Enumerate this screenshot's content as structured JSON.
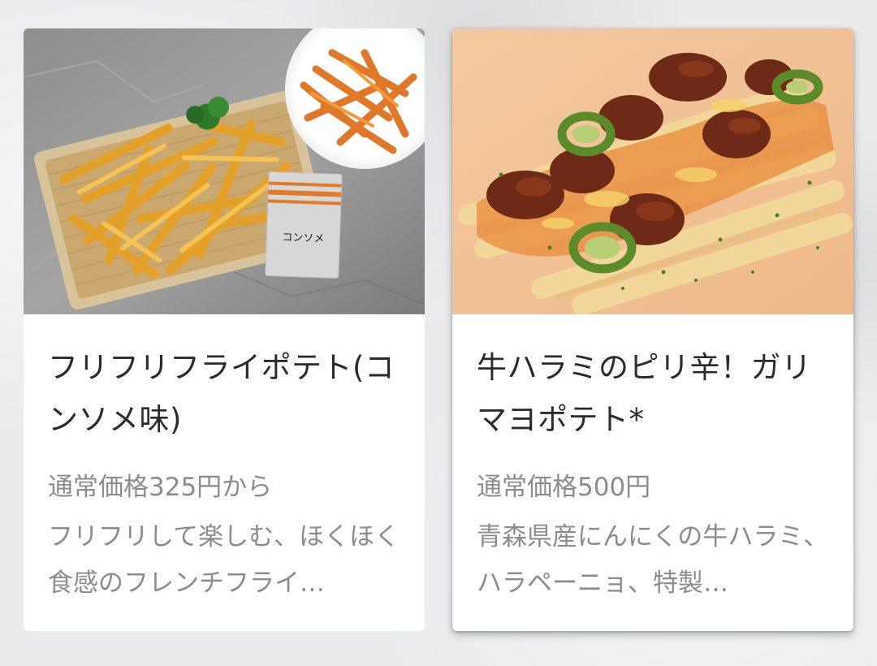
{
  "menu_items": [
    {
      "name": "フリフリフライポテト(コンソメ味)",
      "price_text": "通常価格325円から",
      "description": "フリフリして楽しむ、ほくほく食感のフレンチフライ…",
      "image": {
        "subject": "french-fries-in-basket-with-seasoning-packet",
        "packet_label": "コンソメ"
      }
    },
    {
      "name": "牛ハラミのピリ辛！ガリマヨポテト*",
      "price_text": "通常価格500円",
      "description": "青森県産にんにくの牛ハラミ、ハラペーニョ、特製…",
      "image": {
        "subject": "fries-topped-with-beef-skirt-jalapeno-mayo"
      }
    }
  ],
  "colors": {
    "background": "#e9ebec",
    "card": "#ffffff",
    "title_text": "#2b2b2b",
    "secondary_text": "#8a8d90"
  }
}
